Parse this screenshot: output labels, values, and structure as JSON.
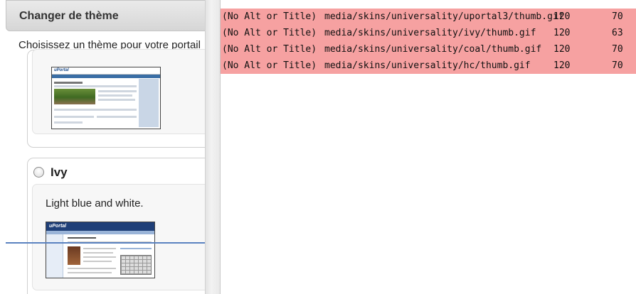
{
  "theme_panel": {
    "header_title": "Changer de thème",
    "instruction": "Choisissez un thème pour votre portail"
  },
  "themes": [
    {
      "name": "",
      "description": "",
      "selected": false
    },
    {
      "name": "Ivy",
      "description": "Light blue and white.",
      "selected": false
    }
  ],
  "thumb_text": {
    "portal_logo": "uPortal",
    "ivy_logo": "uPortal"
  },
  "image_table": {
    "row_color": "#f6a1a1",
    "rows": [
      {
        "alt": "(No Alt or Title)",
        "path": "media/skins/universality/uportal3/thumb.gif",
        "width": "120",
        "height": "70"
      },
      {
        "alt": "(No Alt or Title)",
        "path": "media/skins/universality/ivy/thumb.gif",
        "width": "120",
        "height": "63"
      },
      {
        "alt": "(No Alt or Title)",
        "path": "media/skins/universality/coal/thumb.gif",
        "width": "120",
        "height": "70"
      },
      {
        "alt": "(No Alt or Title)",
        "path": "media/skins/universality/hc/thumb.gif",
        "width": "120",
        "height": "70"
      }
    ]
  }
}
